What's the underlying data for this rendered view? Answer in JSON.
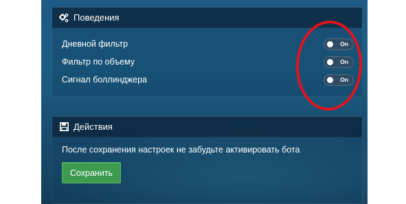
{
  "colors": {
    "background": "#1d5a86",
    "panel_header": "#0a1e32",
    "save_button": "#3d9b4f",
    "highlight": "#e0141e"
  },
  "behaviors": {
    "title": "Поведения",
    "icon": "gears-icon",
    "items": [
      {
        "label": "Дневной фильтр",
        "toggle": "On"
      },
      {
        "label": "Фильтр по объему",
        "toggle": "On"
      },
      {
        "label": "Сигнал боллинджера",
        "toggle": "On"
      }
    ]
  },
  "actions": {
    "title": "Действия",
    "icon": "save-icon",
    "message": "После сохранения настроек не забудьте активировать бота",
    "save_label": "Сохранить"
  }
}
